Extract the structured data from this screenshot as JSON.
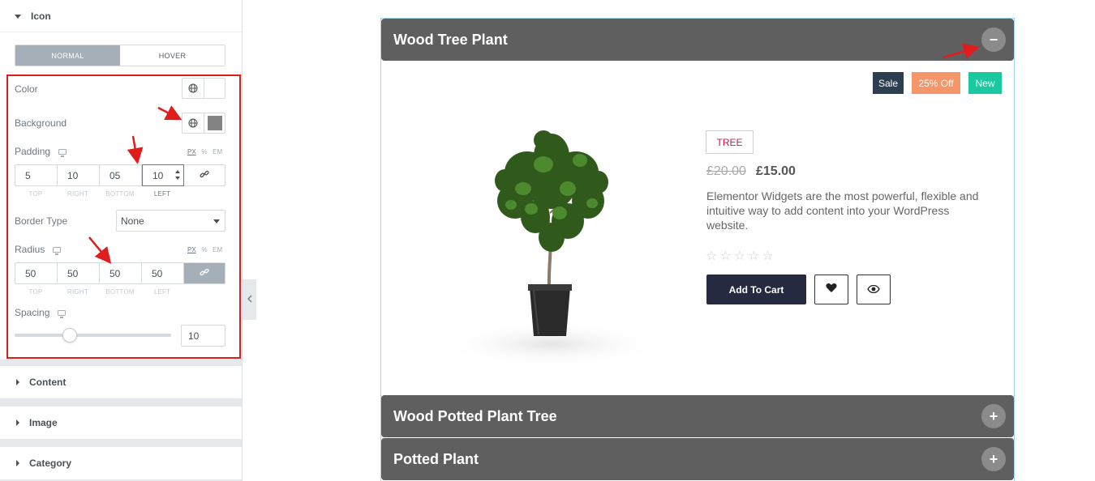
{
  "panel": {
    "icon_section": {
      "title": "Icon"
    },
    "tabs": [
      {
        "label": "NORMAL"
      },
      {
        "label": "HOVER"
      }
    ],
    "color": {
      "label": "Color"
    },
    "background": {
      "label": "Background",
      "swatch_color": "#838383"
    },
    "padding": {
      "label": "Padding",
      "units": [
        "PX",
        "%",
        "EM"
      ],
      "values": [
        "5",
        "10",
        "05",
        "10"
      ],
      "sides": [
        "TOP",
        "RIGHT",
        "BOTTOM",
        "LEFT"
      ]
    },
    "border_type": {
      "label": "Border Type",
      "value": "None"
    },
    "radius": {
      "label": "Radius",
      "units": [
        "PX",
        "%",
        "EM"
      ],
      "values": [
        "50",
        "50",
        "50",
        "50"
      ],
      "sides": [
        "TOP",
        "RIGHT",
        "BOTTOM",
        "LEFT"
      ]
    },
    "spacing": {
      "label": "Spacing",
      "value": "10"
    },
    "sections": [
      {
        "title": "Content"
      },
      {
        "title": "Image"
      },
      {
        "title": "Category"
      }
    ]
  },
  "preview": {
    "accordion": [
      {
        "title": "Wood Tree Plant",
        "toggle": "−"
      },
      {
        "title": "Wood Potted Plant Tree",
        "toggle": "+"
      },
      {
        "title": "Potted Plant",
        "toggle": "+"
      }
    ],
    "badges": [
      {
        "label": "Sale",
        "color": "#2c3e50"
      },
      {
        "label": "25% Off",
        "color": "#f4956a"
      },
      {
        "label": "New",
        "color": "#1bc9a0"
      }
    ],
    "product": {
      "category": "TREE",
      "old_price": "£20.00",
      "price": "£15.00",
      "description": "Elementor Widgets are the most powerful, flexible and intuitive way to add content into your WordPress website.",
      "stars": "☆☆☆☆☆",
      "add_to_cart": "Add To Cart"
    }
  },
  "colors": {
    "accent_red": "#e01d1d",
    "accordion_bg": "#5f5f5f",
    "button_dark": "#262a40"
  }
}
